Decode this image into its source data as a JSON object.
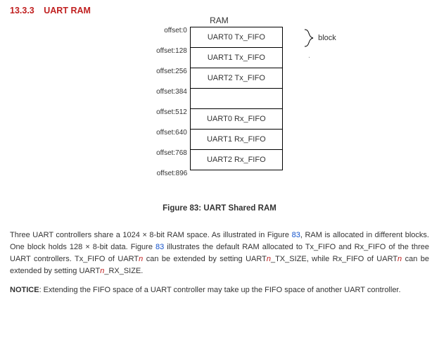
{
  "section": {
    "number": "13.3.3",
    "title": "UART RAM"
  },
  "ram": {
    "title": "RAM",
    "brace_label": "block",
    "offsets": [
      "offset:0",
      "offset:128",
      "offset:256",
      "offset:384",
      "offset:512",
      "offset:640",
      "offset:768",
      "offset:896"
    ],
    "cells": [
      "UART0 Tx_FIFO",
      "UART1 Tx_FIFO",
      "UART2 Tx_FIFO",
      "",
      "UART0 Rx_FIFO",
      "UART1 Rx_FIFO",
      "UART2 Rx_FIFO"
    ]
  },
  "figure": {
    "number": "Figure 83",
    "sep": ": ",
    "title": "UART Shared RAM",
    "ref_text": "83"
  },
  "para1": {
    "a": "Three UART controllers share a 1024 × 8-bit RAM space. As illustrated in Figure ",
    "b": ", RAM is allocated in different blocks. One block holds 128 × 8-bit data. Figure ",
    "c": " illustrates the default RAM allocated to Tx_FIFO and Rx_FIFO of the three UART controllers. Tx_FIFO of UART",
    "d": " can be extended by setting UART",
    "e": "_TX_SIZE, while Rx_FIFO of UART",
    "f": " can be extended by setting UART",
    "g": "_RX_SIZE.",
    "n": "n"
  },
  "notice": {
    "label": "NOTICE",
    "text": ": Extending the FIFO space of a UART controller may take up the FIFO space of another UART controller."
  }
}
